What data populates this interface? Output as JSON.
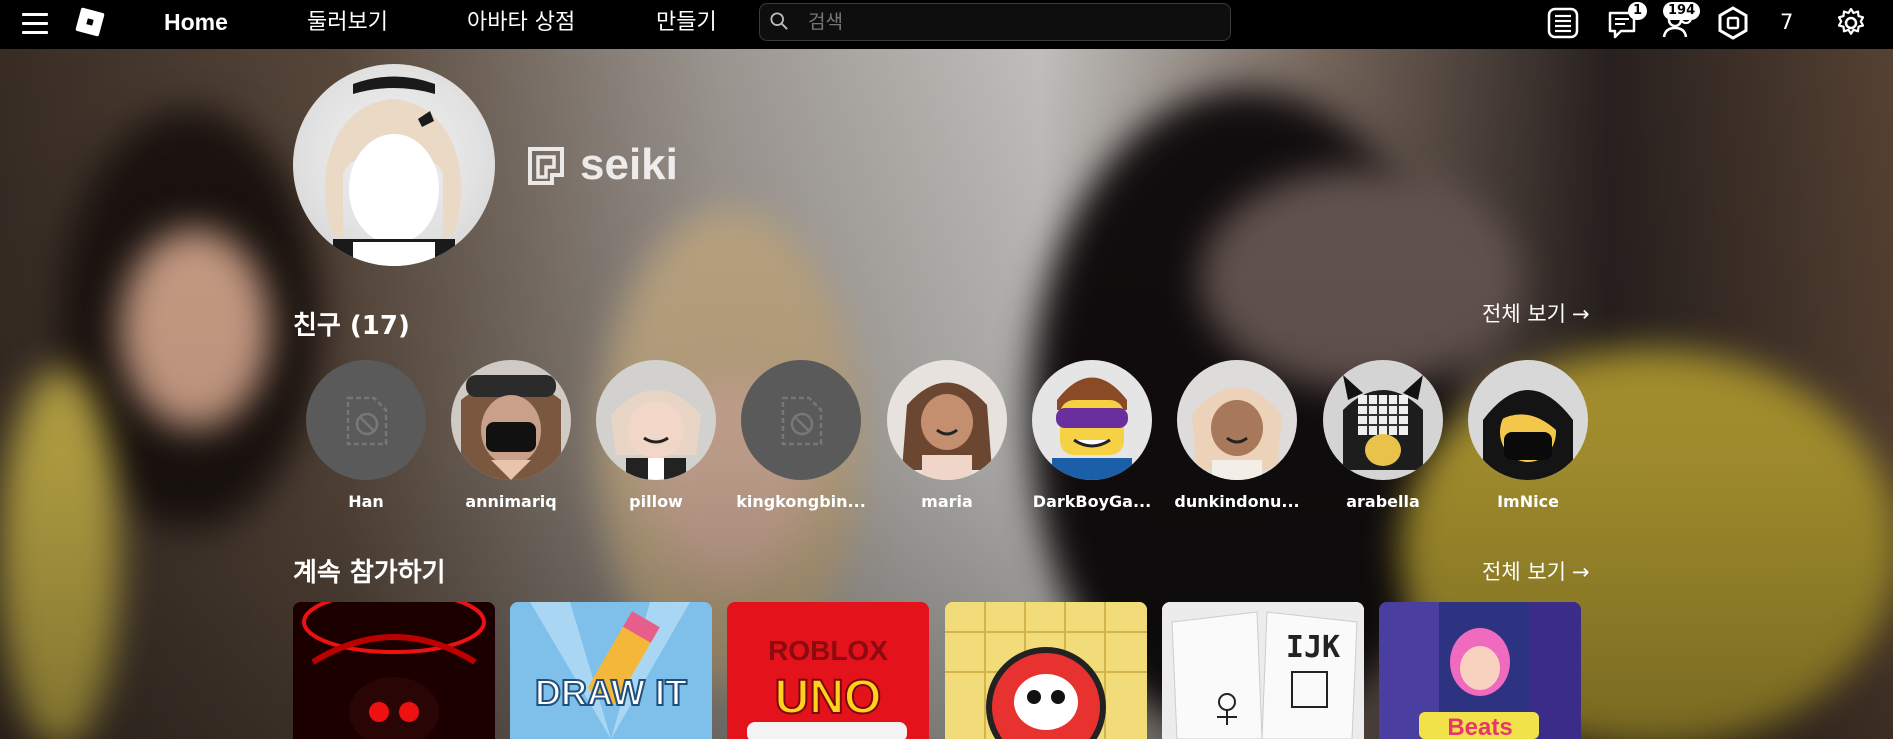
{
  "topbar": {
    "home_label": "Home",
    "nav": [
      "둘러보기",
      "아바타 상점",
      "만들기"
    ],
    "search_placeholder": "검색",
    "chat_badge": "1",
    "friends_badge": "194",
    "robux_count": "7"
  },
  "profile": {
    "username": "seiki"
  },
  "friends": {
    "title": "친구 (17)",
    "see_all": "전체 보기",
    "items": [
      {
        "name": "Han",
        "placeholder": true
      },
      {
        "name": "annimariq",
        "placeholder": false
      },
      {
        "name": "pillow",
        "placeholder": false
      },
      {
        "name": "kingkongbin...",
        "placeholder": true
      },
      {
        "name": "maria",
        "placeholder": false
      },
      {
        "name": "DarkBoyGa...",
        "placeholder": false
      },
      {
        "name": "dunkindonu...",
        "placeholder": false
      },
      {
        "name": "arabella",
        "placeholder": false
      },
      {
        "name": "ImNice",
        "placeholder": false
      }
    ]
  },
  "continue": {
    "title": "계속 참가하기",
    "see_all": "전체 보기",
    "games": [
      {
        "label": ""
      },
      {
        "label": "DRAW IT"
      },
      {
        "label_top": "ROBLOX",
        "label": "UNO"
      },
      {
        "label": ""
      },
      {
        "label": "IJK"
      },
      {
        "label": "Beats"
      }
    ]
  },
  "colors": {
    "topbar_bg": "#000000",
    "placeholder_bg": "#5a5a5a",
    "uno_red": "#e3121b",
    "draw_blue": "#6bb3e6"
  }
}
